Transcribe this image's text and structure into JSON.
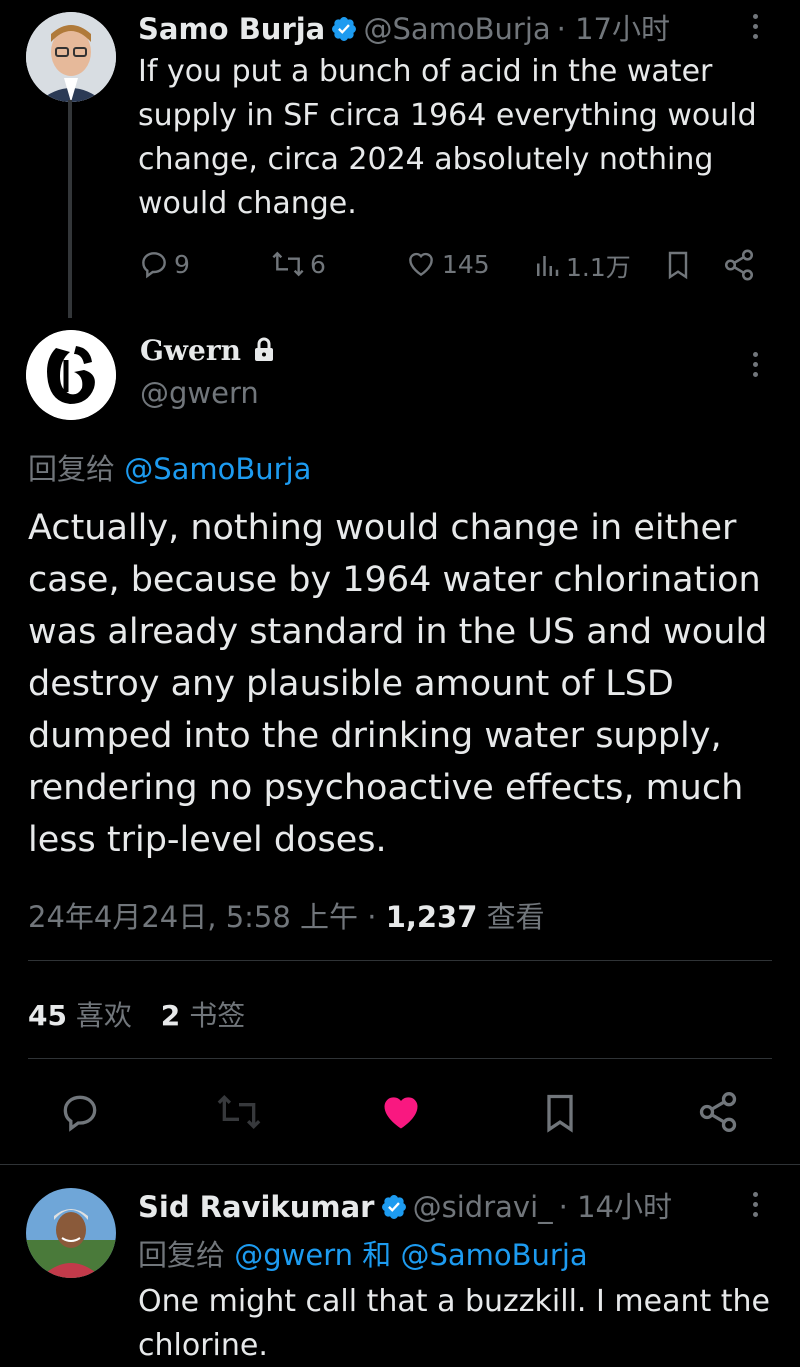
{
  "parent_tweet": {
    "name": "Samo Burja",
    "handle": "@SamoBurja",
    "time": "· 17小时",
    "text": "If you put a bunch of acid in the water supply in SF circa 1964 everything would change, circa 2024 absolutely nothing would change.",
    "replies": "9",
    "retweets": "6",
    "likes": "145",
    "views": "1.1万"
  },
  "main_tweet": {
    "name": "Gwern",
    "handle": "@gwern",
    "reply_prefix": "回复给",
    "reply_to": "@SamoBurja",
    "text": "Actually, nothing would change in either case, because by 1964 water chlorination was already standard in the US and would destroy any plausible amount of LSD dumped into the drinking water supply, rendering no psychoactive effects, much less trip-level doses.",
    "date": "24年4月24日, 5:58 上午 · ",
    "views_count": "1,237",
    "views_label": " 查看",
    "likes_count": "45",
    "likes_label": "喜欢",
    "bookmarks_count": "2",
    "bookmarks_label": "书签",
    "like_color": "#f91880"
  },
  "reply_tweet": {
    "name": "Sid Ravikumar",
    "handle": "@sidravi_",
    "time": "· 14小时",
    "reply_prefix": "回复给",
    "reply_to_1": "@gwern",
    "reply_joiner": "和",
    "reply_to_2": "@SamoBurja",
    "text": "One might call that a buzzkill. I meant the chlorine."
  },
  "colors": {
    "accent": "#1d9bf0",
    "muted": "#71767b",
    "background": "#000000",
    "verified": "#1d9bf0"
  }
}
